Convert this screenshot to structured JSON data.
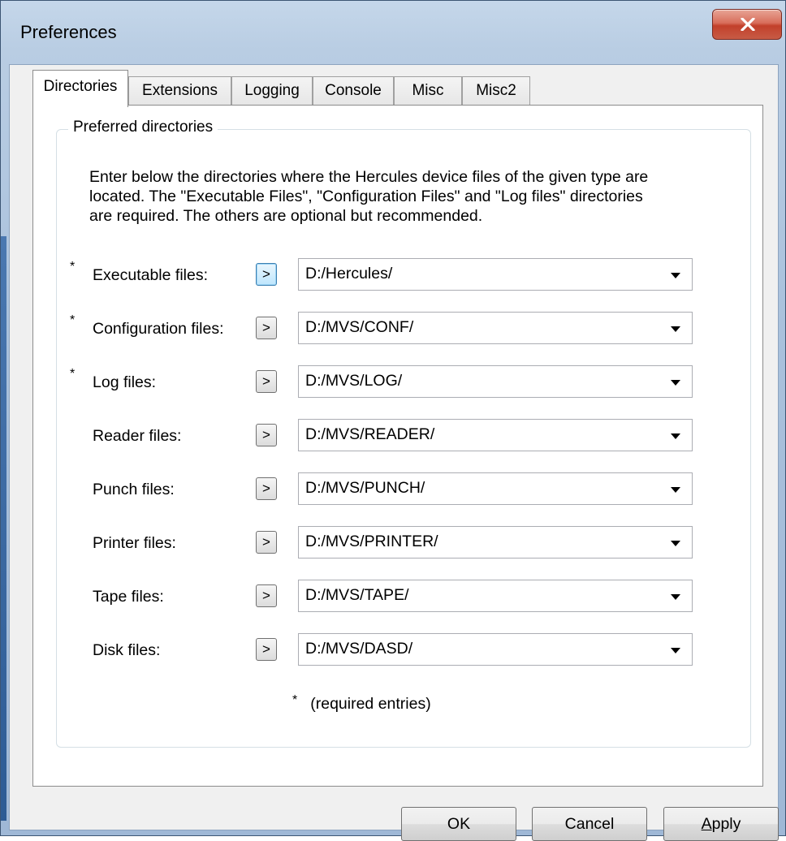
{
  "window": {
    "title": "Preferences",
    "close_icon": "close-x-icon"
  },
  "tabs": [
    {
      "label": "Directories",
      "active": true
    },
    {
      "label": "Extensions",
      "active": false
    },
    {
      "label": "Logging",
      "active": false
    },
    {
      "label": "Console",
      "active": false
    },
    {
      "label": "Misc",
      "active": false
    },
    {
      "label": "Misc2",
      "active": false
    }
  ],
  "group": {
    "title": "Preferred directories",
    "intro_lines": [
      "Enter below the directories where the Hercules device files of the given type are",
      "located. The \"Executable Files\", \"Configuration Files\" and \"Log files\" directories",
      "are required. The others are optional but recommended."
    ]
  },
  "rows": [
    {
      "required": true,
      "marker": "*",
      "label": "Executable files:",
      "browse_label": ">",
      "value": "D:/Hercules/"
    },
    {
      "required": true,
      "marker": "*",
      "label": "Configuration files:",
      "browse_label": ">",
      "value": "D:/MVS/CONF/"
    },
    {
      "required": true,
      "marker": "*",
      "label": "Log files:",
      "browse_label": ">",
      "value": "D:/MVS/LOG/"
    },
    {
      "required": false,
      "marker": "",
      "label": "Reader files:",
      "browse_label": ">",
      "value": "D:/MVS/READER/"
    },
    {
      "required": false,
      "marker": "",
      "label": "Punch files:",
      "browse_label": ">",
      "value": "D:/MVS/PUNCH/"
    },
    {
      "required": false,
      "marker": "",
      "label": "Printer files:",
      "browse_label": ">",
      "value": "D:/MVS/PRINTER/"
    },
    {
      "required": false,
      "marker": "",
      "label": "Tape files:",
      "browse_label": ">",
      "value": "D:/MVS/TAPE/"
    },
    {
      "required": false,
      "marker": "",
      "label": "Disk files:",
      "browse_label": ">",
      "value": "D:/MVS/DASD/"
    }
  ],
  "required_note": {
    "marker": "*",
    "text": "(required entries)"
  },
  "buttons": {
    "ok": "OK",
    "cancel": "Cancel",
    "apply": "Apply"
  },
  "colors": {
    "frame": "#b9cde3",
    "close_button": "#c75b45",
    "focus_accent": "#3c7fb1"
  }
}
